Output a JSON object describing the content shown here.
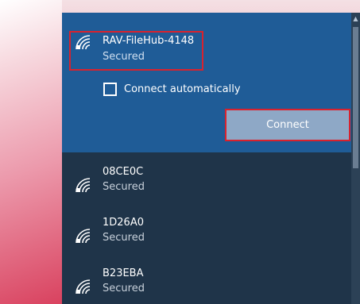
{
  "wifi_flyout": {
    "selected_network": {
      "name": "RAV-FileHub-4148",
      "status": "Secured",
      "icon": "wifi-secured-icon"
    },
    "connect_automatically": {
      "label": "Connect automatically",
      "checked": false
    },
    "connect_button": {
      "label": "Connect"
    },
    "networks": [
      {
        "name": "08CE0C",
        "status": "Secured",
        "icon": "wifi-secured-icon"
      },
      {
        "name": "1D26A0",
        "status": "Secured",
        "icon": "wifi-secured-icon"
      },
      {
        "name": "B23EBA",
        "status": "Secured",
        "icon": "wifi-secured-icon"
      }
    ],
    "colors": {
      "selected_panel": "#1f5c97",
      "flyout_background": "#1f3449",
      "highlight_border": "#d8222e",
      "connect_button": "#8ea8c6"
    }
  }
}
